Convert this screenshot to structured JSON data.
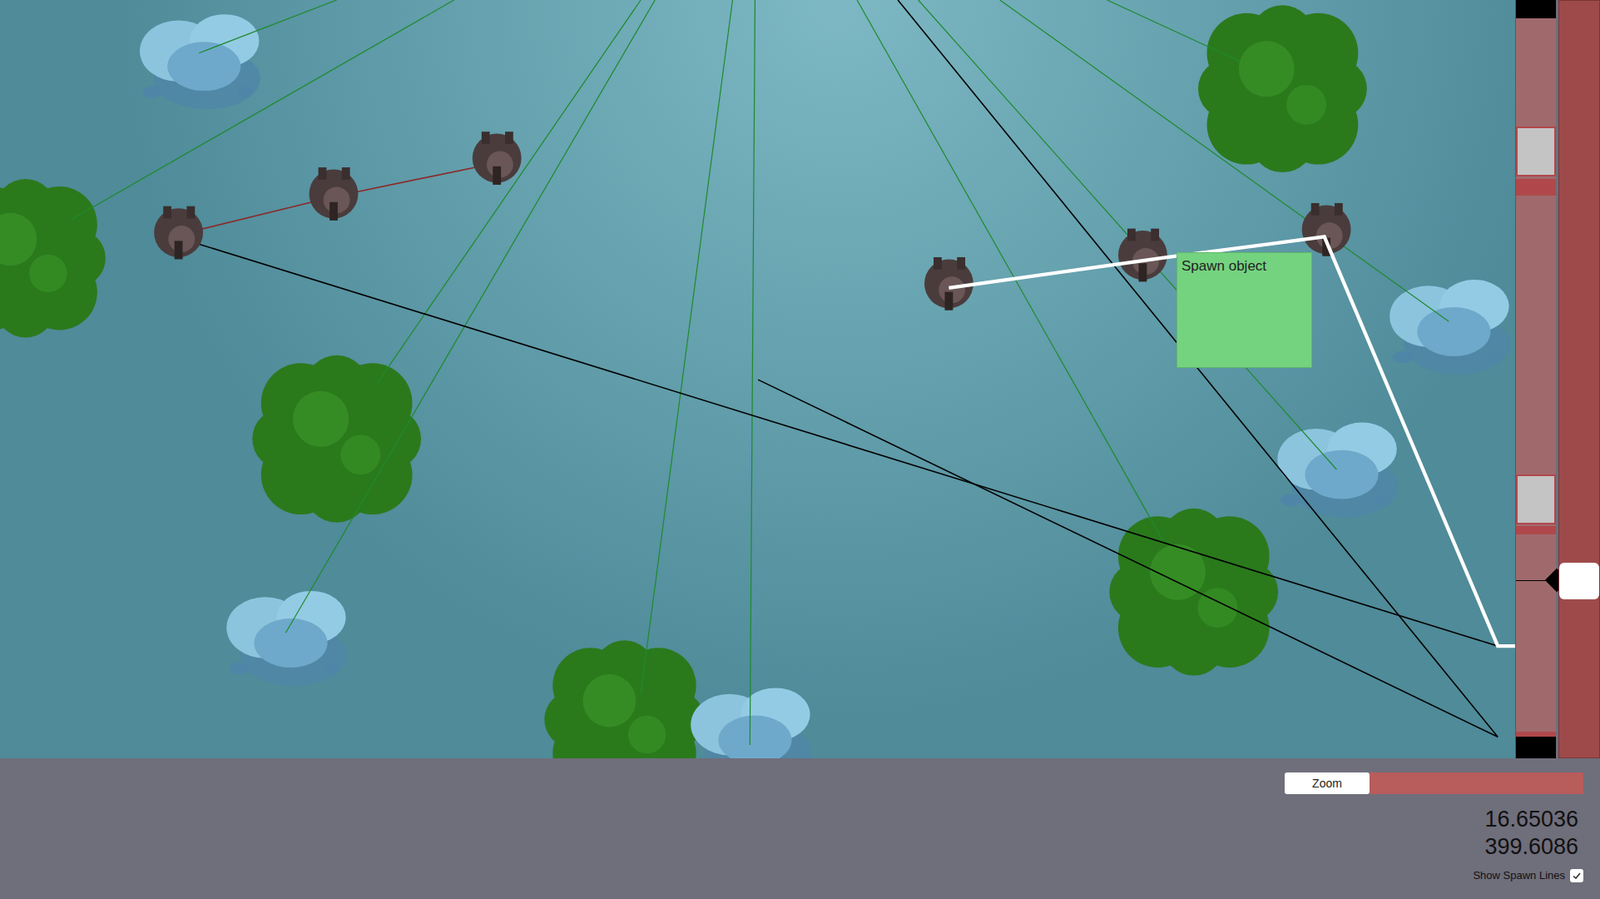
{
  "canvas": {
    "spawn_object": {
      "label": "Spawn object"
    }
  },
  "timeline": {
    "level": 0.765
  },
  "zoom": {
    "label": "Zoom"
  },
  "readouts": [
    "16.65036",
    "399.6086"
  ],
  "show_spawn_lines": {
    "label": "Show Spawn Lines",
    "checked": true
  }
}
